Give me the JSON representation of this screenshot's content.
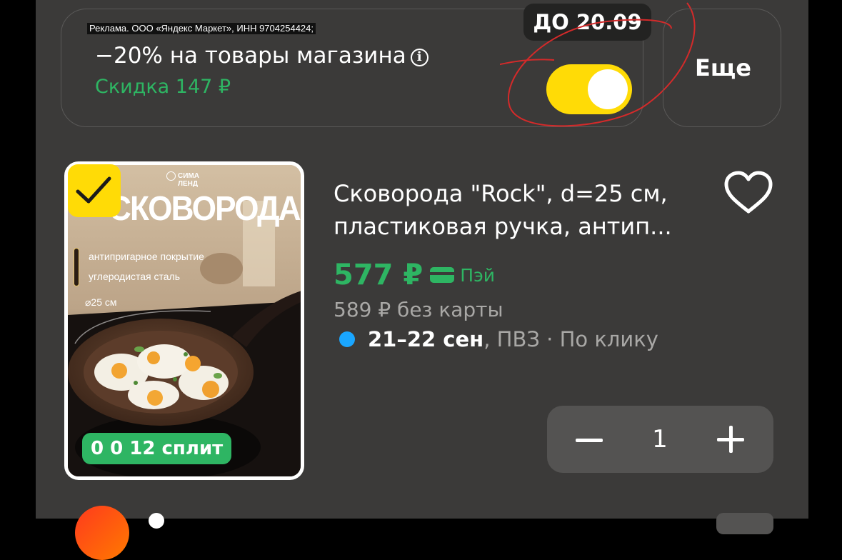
{
  "promo": {
    "ad_disclaimer": "Реклама. ООО «Яндекс Маркет», ИНН 9704254424;",
    "title": "−20% на товары магазина",
    "discount": "Скидка 147 ₽",
    "deadline": "ДО 20.09",
    "toggle_on": true
  },
  "more": {
    "label": "Еще"
  },
  "product": {
    "image_brand": "СИМА ЛЕНД",
    "image_title": "СКОВОРОДА",
    "image_feature_1": "антипригарное покрытие",
    "image_feature_2": "углеродистая сталь",
    "image_diameter": "⌀25 см",
    "split_badge": "0 0 12 сплит",
    "title_line1": "Сковорода \"Rock\", d=25 см,",
    "title_line2": "пластиковая ручка, антип...",
    "price": "577 ₽",
    "pay_label": "Пэй",
    "old_price": "589 ₽  без карты",
    "delivery_date": "21–22 сен",
    "delivery_rest": ", ПВЗ · По клику",
    "selected": true,
    "favorite": false
  },
  "stepper": {
    "quantity": "1"
  },
  "colors": {
    "background": "#3b3a39",
    "accent_yellow": "#ffdb06",
    "green": "#2eb563",
    "dot_blue": "#1aa6ff"
  }
}
